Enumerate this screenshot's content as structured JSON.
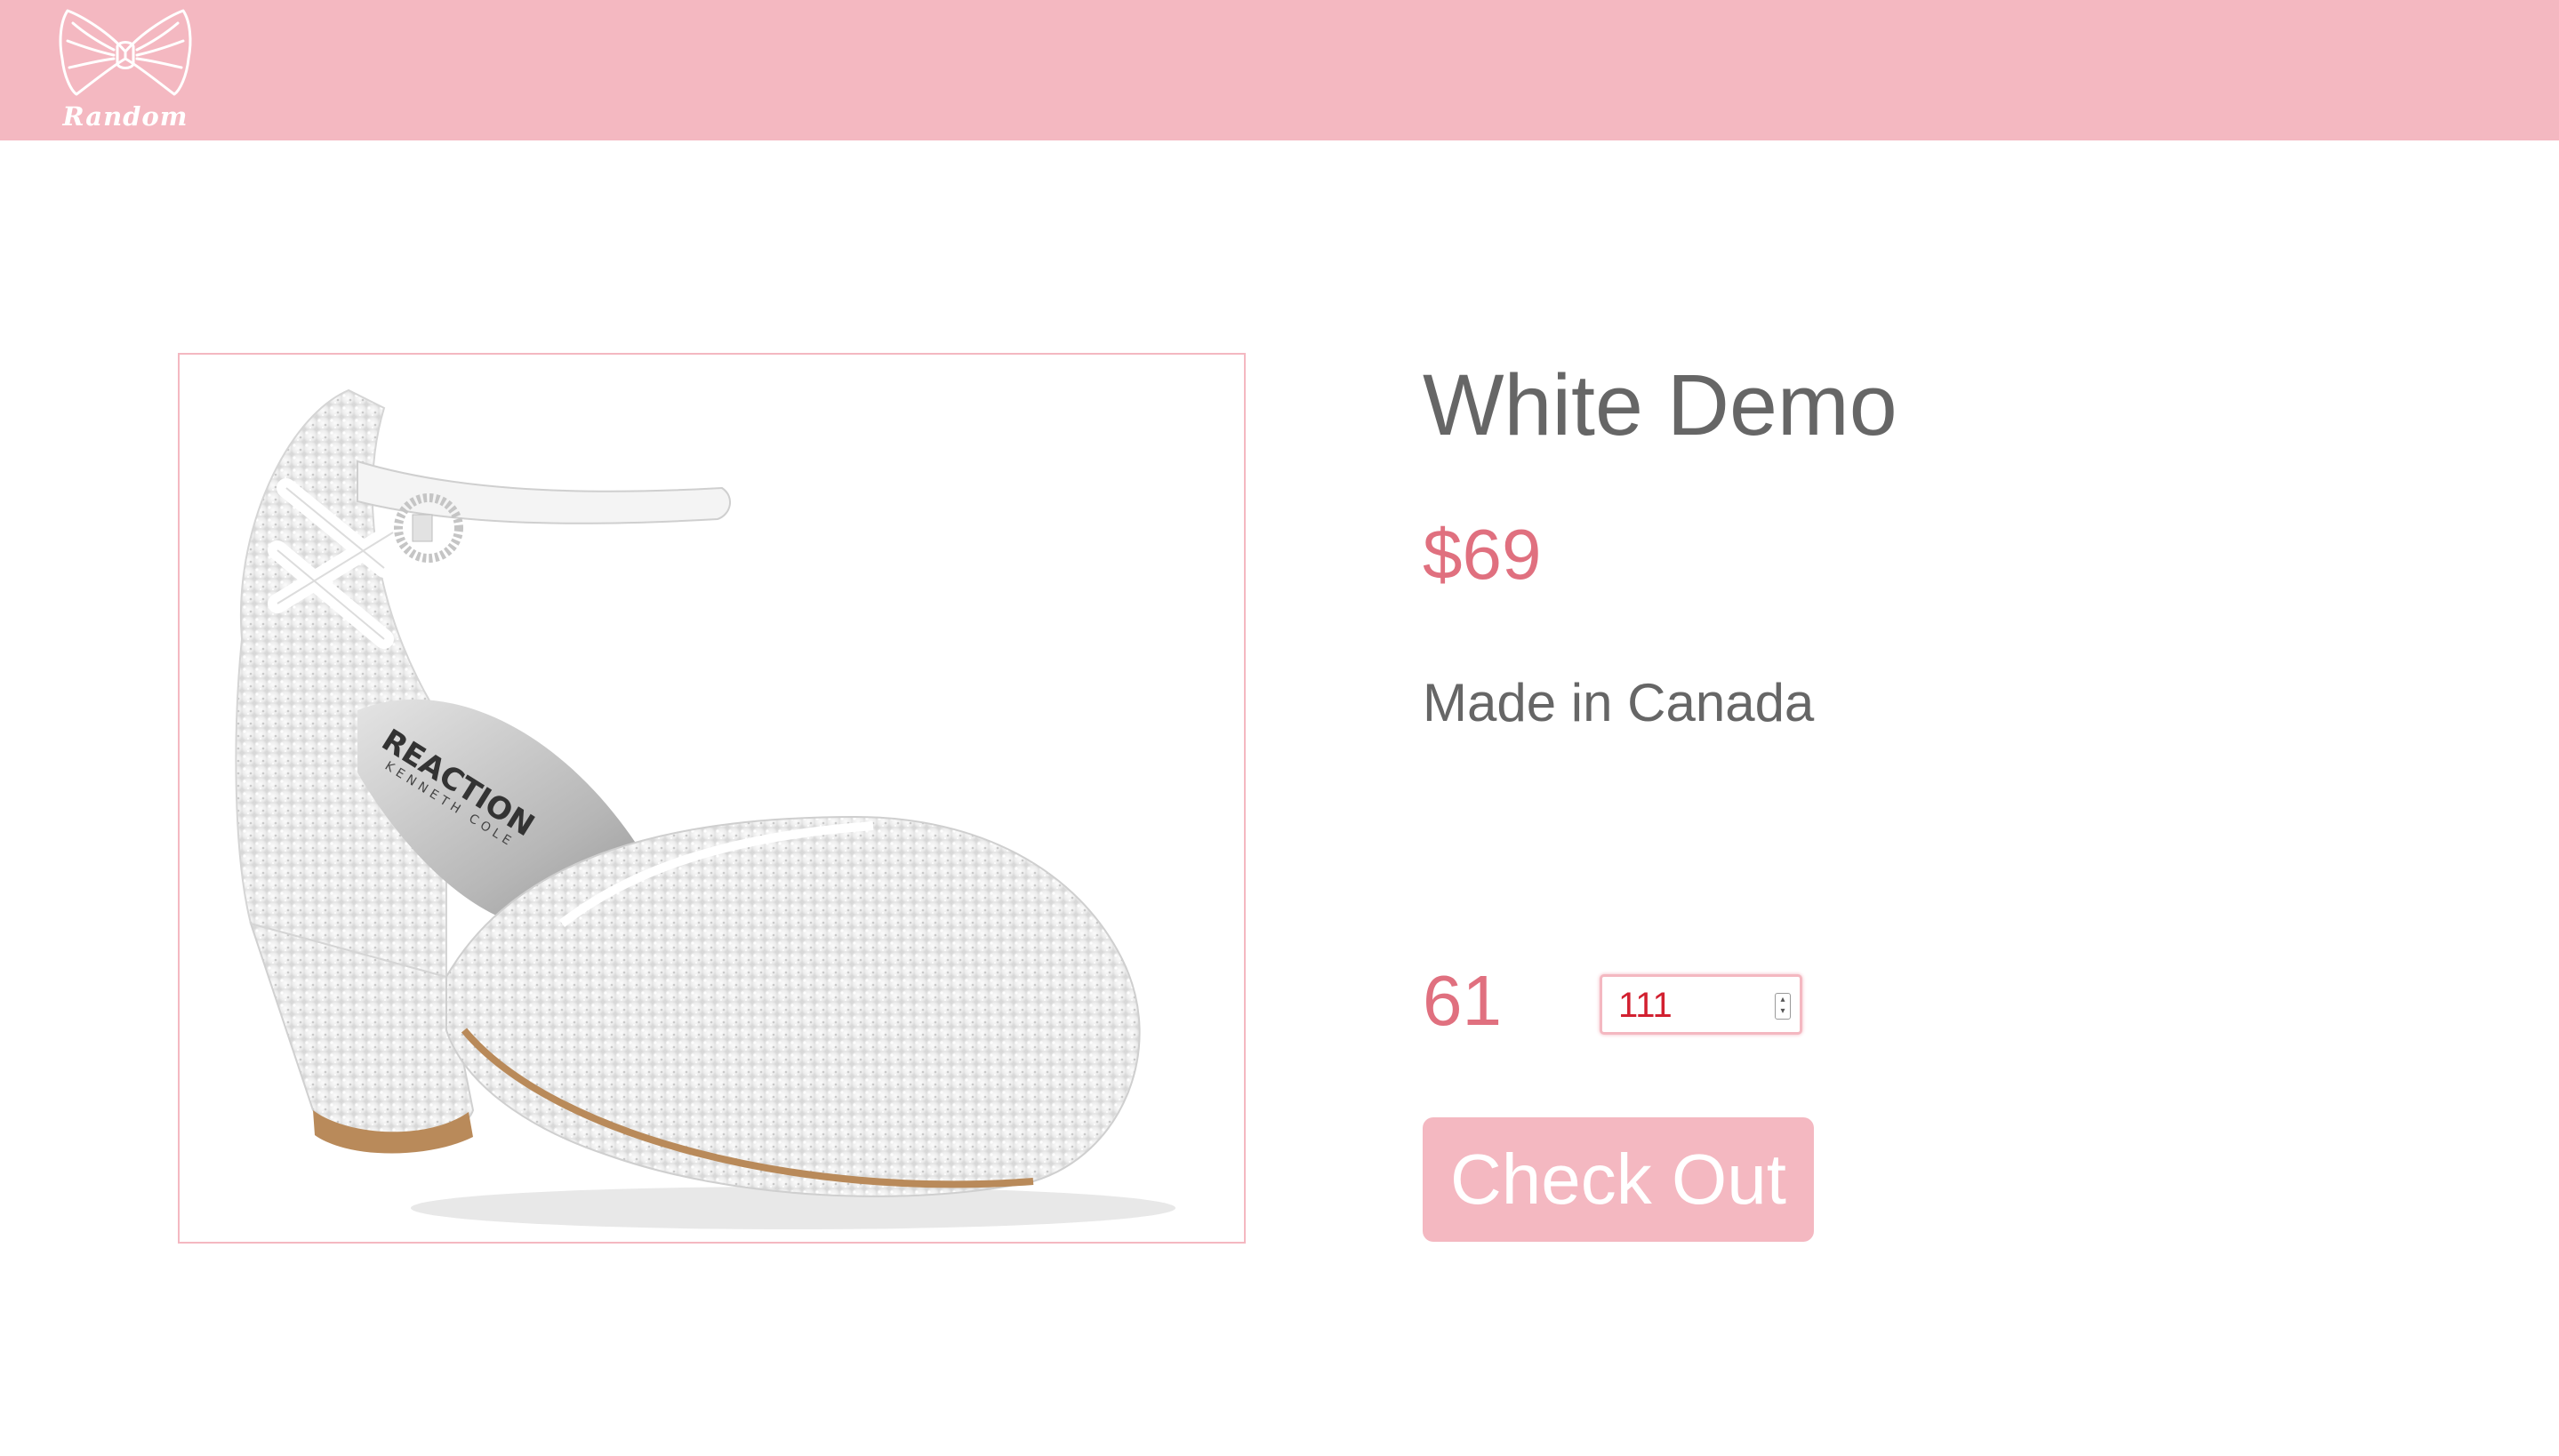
{
  "header": {
    "logo_text": "Random",
    "background_color": "#f4b8c1"
  },
  "product": {
    "image_alt": "white glitter low heel shoe",
    "title": "White Demo",
    "price": "$69",
    "origin": "Made in Canada",
    "quantity_label": "61",
    "quantity_value": "111",
    "checkout_label": "Check Out"
  },
  "colors": {
    "accent_pink": "#f4b8c1",
    "price_pink": "#e0707f",
    "text_gray": "#666666"
  }
}
